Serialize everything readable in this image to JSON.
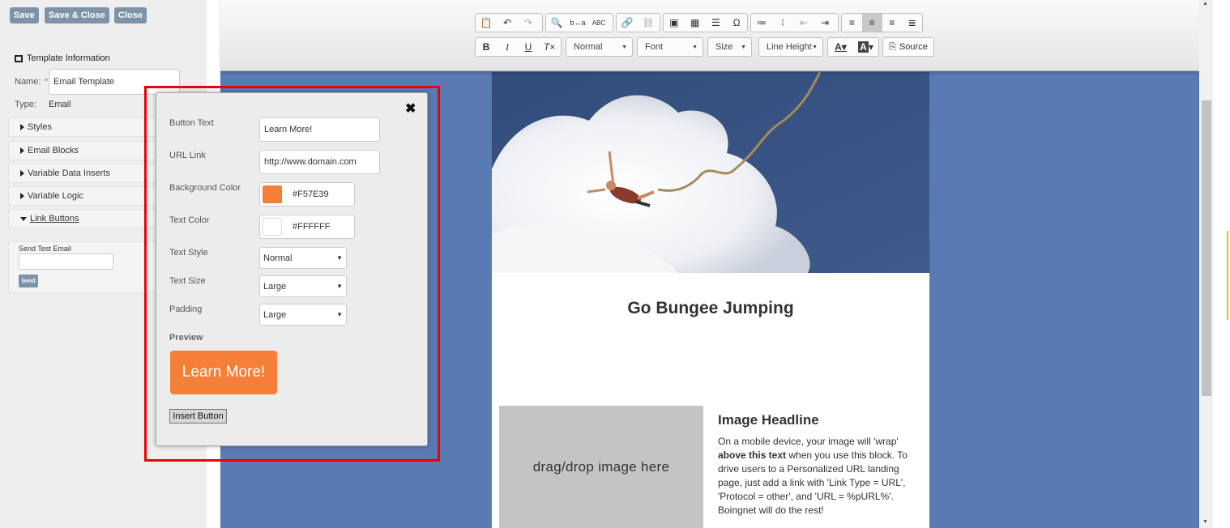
{
  "sidebar": {
    "buttons": {
      "save": "Save",
      "save_close": "Save & Close",
      "close": "Close"
    },
    "template_info_title": "Template Information",
    "name_label": "Name:",
    "required_mark": "*",
    "name_value": "Email Template",
    "type_label": "Type:",
    "type_value": "Email",
    "sections": [
      "Styles",
      "Email Blocks",
      "Variable Data Inserts",
      "Variable Logic",
      "Link Buttons"
    ],
    "send_test_label": "Send Test Email",
    "send_button": "Send"
  },
  "toolbar": {
    "format_combo": "Normal",
    "font_combo": "Font",
    "size_combo": "Size",
    "line_height_combo": "Line Height",
    "source_label": "Source"
  },
  "email": {
    "headline": "Go Bungee Jumping",
    "image_placeholder": "drag/drop image here",
    "image_headline": "Image Headline",
    "body_part1": "On a mobile device, your image will 'wrap' ",
    "body_bold": "above this text",
    "body_part2": " when you use this block. To drive users to a Personalized URL landing page, just add a link with 'Link Type = URL', 'Protocol = other', and 'URL = %pURL%'. Boingnet will do the rest!"
  },
  "dialog": {
    "button_text_label": "Button Text",
    "button_text_value": "Learn More!",
    "url_label": "URL Link",
    "url_value": "http://www.domain.com",
    "bg_color_label": "Background Color",
    "bg_color_value": "#F57E39",
    "text_color_label": "Text Color",
    "text_color_value": "#FFFFFF",
    "text_style_label": "Text Style",
    "text_style_value": "Normal",
    "text_size_label": "Text Size",
    "text_size_value": "Large",
    "padding_label": "Padding",
    "padding_value": "Large",
    "preview_label": "Preview",
    "preview_button": "Learn More!",
    "insert_button": "Insert Button"
  },
  "colors": {
    "bg_swatch": "#F57E39",
    "text_swatch": "#FFFFFF",
    "canvas": "#5a7ab4",
    "highlight": "#ee0000"
  }
}
